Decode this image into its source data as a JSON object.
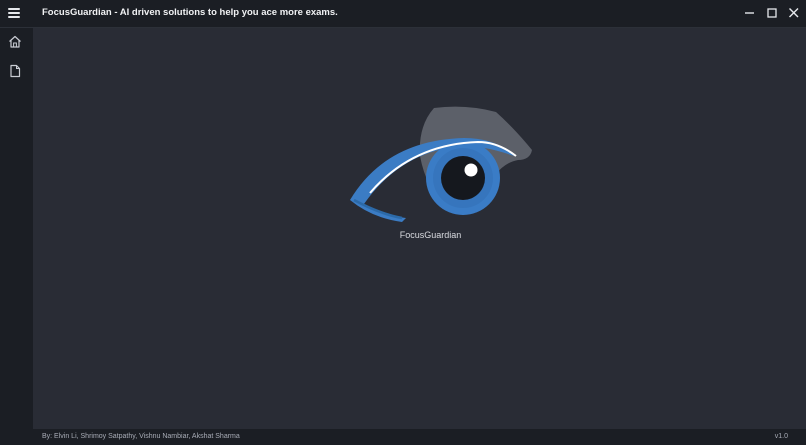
{
  "app": {
    "title": "FocusGuardian - AI driven solutions to help you ace more exams."
  },
  "window_controls": {
    "minimize_icon": "minimize-icon",
    "maximize_icon": "maximize-icon",
    "close_icon": "close-icon"
  },
  "sidebar": {
    "items": [
      {
        "icon": "home-icon"
      },
      {
        "icon": "document-icon"
      }
    ]
  },
  "main": {
    "logo_label": "FocusGuardian"
  },
  "footer": {
    "credits": "By: Elvin Li, Shrimoy Satpathy, Vishnu Nambiar, Akshat Sharma",
    "version": "v1.0"
  },
  "colors": {
    "accent_blue": "#3b7cc4",
    "background": "#292c35"
  }
}
